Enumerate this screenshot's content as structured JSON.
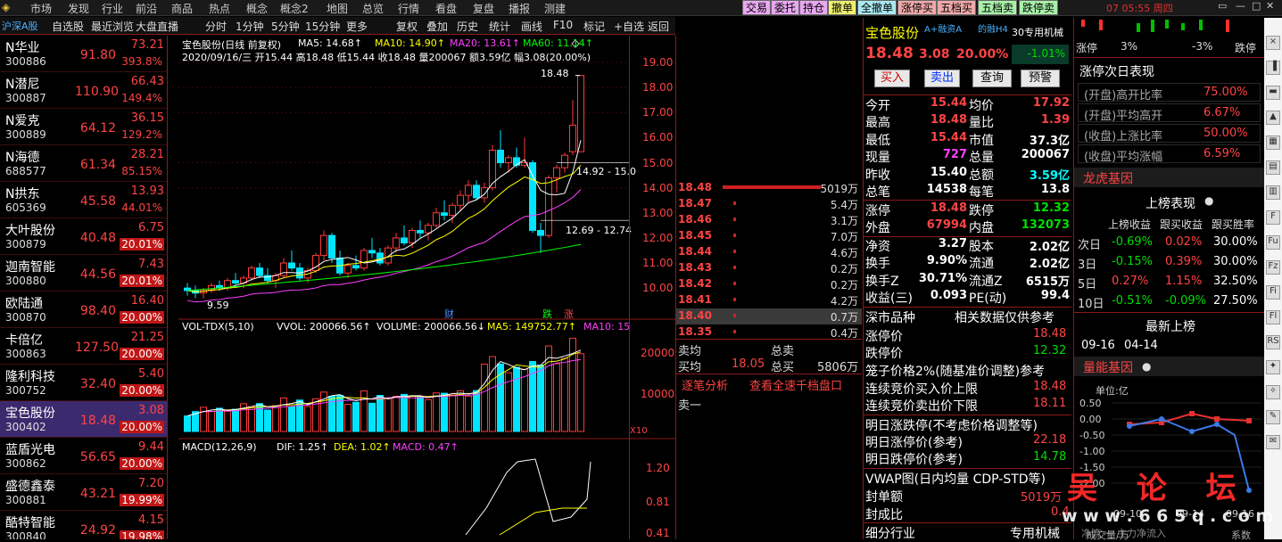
{
  "menu": {
    "items": [
      "市场",
      "发现",
      "行业",
      "前沿",
      "商品",
      "热点",
      "概念",
      "概念2",
      "地图",
      "总览",
      "行情",
      "看盘",
      "复盘",
      "播报",
      "测建"
    ],
    "buttons": [
      {
        "label": "交易",
        "color": "#e8a8f0"
      },
      {
        "label": "委托",
        "color": "#e8a8f0"
      },
      {
        "label": "持仓",
        "color": "#e8a8f0"
      },
      {
        "label": "撤单",
        "color": "#f0f070"
      },
      {
        "label": "全撤单",
        "color": "#a8e8f0"
      },
      {
        "label": "涨停买",
        "color": "#f0a8a8"
      },
      {
        "label": "五档买",
        "color": "#f0a8a8"
      },
      {
        "label": "五档卖",
        "color": "#a8f0a8"
      },
      {
        "label": "跌停卖",
        "color": "#a8f0a8"
      }
    ],
    "clock": "07 05:55 周四"
  },
  "toolbar": {
    "market": "沪深A股",
    "tabs": [
      "自选股",
      "最近浏览",
      "大盘直播"
    ],
    "periods": [
      "分时",
      "1分钟",
      "5分钟",
      "15分钟",
      "更多"
    ],
    "tools": [
      "复权",
      "叠加",
      "历史",
      "统计",
      "画线",
      "F10",
      "标记",
      "+自选",
      "返回"
    ]
  },
  "stocks": [
    {
      "name": "N华业",
      "code": "300886",
      "price": "91.80",
      "change": "73.21",
      "pct": "393.8%",
      "box": false
    },
    {
      "name": "N潜尼",
      "code": "300887",
      "price": "110.90",
      "change": "66.43",
      "pct": "149.4%",
      "box": false
    },
    {
      "name": "N爱克",
      "code": "300889",
      "price": "64.12",
      "change": "36.15",
      "pct": "129.2%",
      "box": false
    },
    {
      "name": "N海德",
      "code": "688577",
      "price": "61.34",
      "change": "28.21",
      "pct": "85.15%",
      "box": false
    },
    {
      "name": "N拱东",
      "code": "605369",
      "price": "45.58",
      "change": "13.93",
      "pct": "44.01%",
      "box": false
    },
    {
      "name": "大叶股份",
      "code": "300879",
      "price": "40.48",
      "change": "6.75",
      "pct": "20.01%",
      "box": true
    },
    {
      "name": "迦南智能",
      "code": "300880",
      "price": "44.56",
      "change": "7.43",
      "pct": "20.01%",
      "box": true
    },
    {
      "name": "欧陆通",
      "code": "300870",
      "price": "98.40",
      "change": "16.40",
      "pct": "20.00%",
      "box": true
    },
    {
      "name": "卡倍亿",
      "code": "300863",
      "price": "127.50",
      "change": "21.25",
      "pct": "20.00%",
      "box": true
    },
    {
      "name": "隆利科技",
      "code": "300752",
      "price": "32.40",
      "change": "5.40",
      "pct": "20.00%",
      "box": true
    },
    {
      "name": "宝色股份",
      "code": "300402",
      "price": "18.48",
      "change": "3.08",
      "pct": "20.00%",
      "box": true
    },
    {
      "name": "蓝盾光电",
      "code": "300862",
      "price": "56.65",
      "change": "9.44",
      "pct": "20.00%",
      "box": true
    },
    {
      "name": "盛德鑫泰",
      "code": "300881",
      "price": "43.21",
      "change": "7.20",
      "pct": "19.99%",
      "box": true
    },
    {
      "name": "酷特智能",
      "code": "300840",
      "price": "24.92",
      "change": "4.15",
      "pct": "19.98%",
      "box": true
    }
  ],
  "chart": {
    "title": "宝色股份(日线 前复权)",
    "ma5": "MA5: 14.68↑",
    "ma10": "MA10: 14.90↑",
    "ma20": "MA20: 13.61↑",
    "ma60": "MA60: 11.14↑",
    "ohlc": "2020/09/16/三 开15.44 高18.48 低15.44 收18.48 量200067 额3.59亿 幅3.08(20.00%)",
    "high_label": "18.48",
    "low_label": "9.59",
    "range1": "14.92 - 15.0",
    "range2": "12.69 - 12.74",
    "event_cai": "财",
    "event_die": "跌",
    "event_zhang": "涨",
    "vol_title": "VOL-TDX(5,10)",
    "vvol": "VVOL: 200066.56↑",
    "volume": "VOLUME: 200066.56↓",
    "vma5": "MA5: 149752.77↑",
    "vma10": "MA10: 15",
    "vol_unit": "X10",
    "macd_title": "MACD(12,26,9)",
    "dif": "DIF: 1.25↑",
    "dea": "DEA: 1.02↑",
    "macd": "MACD: 0.47↑",
    "price_ticks": [
      "19.00",
      "18.00",
      "17.00",
      "16.00",
      "15.00",
      "14.00",
      "13.00",
      "12.00",
      "11.00",
      "10.00"
    ],
    "vol_ticks": [
      "20000",
      "10000"
    ],
    "macd_ticks": [
      "1.20",
      "0.81",
      "0.41"
    ]
  },
  "chart_data": {
    "type": "candlestick",
    "title": "宝色股份(日线 前复权)",
    "candles": [
      [
        10.0,
        10.2,
        9.7,
        9.9
      ],
      [
        9.9,
        10.1,
        9.6,
        9.8
      ],
      [
        9.8,
        10.0,
        9.59,
        9.9
      ],
      [
        9.9,
        10.2,
        9.8,
        10.1
      ],
      [
        10.1,
        10.3,
        9.9,
        10.0
      ],
      [
        10.0,
        10.4,
        9.9,
        10.3
      ],
      [
        10.3,
        10.6,
        10.1,
        10.2
      ],
      [
        10.2,
        10.5,
        10.0,
        10.4
      ],
      [
        10.4,
        10.9,
        10.3,
        10.8
      ],
      [
        10.8,
        11.0,
        10.4,
        10.5
      ],
      [
        10.5,
        10.8,
        10.2,
        10.3
      ],
      [
        10.3,
        10.6,
        10.0,
        10.5
      ],
      [
        10.5,
        11.2,
        10.4,
        11.0
      ],
      [
        11.0,
        11.5,
        10.7,
        10.8
      ],
      [
        10.8,
        11.0,
        10.3,
        10.4
      ],
      [
        10.4,
        10.8,
        10.2,
        10.7
      ],
      [
        10.7,
        11.4,
        10.6,
        11.3
      ],
      [
        11.3,
        12.3,
        11.1,
        12.1
      ],
      [
        12.1,
        12.2,
        11.0,
        11.2
      ],
      [
        11.2,
        11.5,
        10.5,
        10.6
      ],
      [
        10.6,
        11.0,
        10.4,
        10.9
      ],
      [
        10.9,
        11.3,
        10.7,
        10.8
      ],
      [
        10.8,
        11.6,
        10.7,
        11.5
      ],
      [
        11.5,
        12.0,
        11.2,
        11.4
      ],
      [
        11.4,
        11.6,
        10.9,
        11.0
      ],
      [
        11.0,
        11.7,
        10.9,
        11.6
      ],
      [
        11.6,
        12.2,
        11.4,
        12.0
      ],
      [
        12.0,
        12.5,
        11.7,
        11.8
      ],
      [
        11.8,
        12.4,
        11.6,
        12.3
      ],
      [
        12.3,
        12.7,
        12.0,
        12.2
      ],
      [
        12.2,
        12.6,
        11.9,
        12.5
      ],
      [
        12.5,
        13.2,
        12.4,
        13.0
      ],
      [
        13.0,
        13.5,
        12.7,
        12.9
      ],
      [
        12.9,
        13.4,
        12.6,
        13.3
      ],
      [
        13.3,
        13.9,
        13.1,
        13.7
      ],
      [
        13.7,
        14.3,
        13.4,
        14.1
      ],
      [
        14.1,
        14.3,
        13.5,
        13.6
      ],
      [
        13.6,
        14.2,
        13.4,
        14.0
      ],
      [
        14.0,
        15.7,
        13.9,
        15.5
      ],
      [
        15.5,
        16.3,
        14.8,
        15.0
      ],
      [
        15.0,
        15.3,
        14.6,
        15.2
      ],
      [
        15.2,
        15.6,
        14.8,
        14.9
      ],
      [
        14.9,
        16.0,
        14.8,
        15.0
      ],
      [
        15.0,
        15.1,
        12.2,
        12.3
      ],
      [
        12.3,
        12.6,
        11.4,
        12.1
      ],
      [
        12.1,
        14.5,
        12.0,
        14.4
      ],
      [
        14.4,
        14.92,
        13.8,
        14.8
      ],
      [
        14.8,
        15.4,
        14.6,
        15.3
      ],
      [
        15.44,
        17.5,
        15.3,
        16.5
      ],
      [
        15.44,
        18.48,
        15.44,
        18.48
      ]
    ],
    "volume_ylim": [
      0,
      25000
    ],
    "price_ylim": [
      9.4,
      19.5
    ]
  },
  "orderbook": {
    "rows": [
      {
        "price": "18.48",
        "vol": "5019万",
        "w": 110,
        "hl": false
      },
      {
        "price": "18.47",
        "vol": "5.4万",
        "w": 3,
        "hl": false
      },
      {
        "price": "18.46",
        "vol": "3.1万",
        "w": 3,
        "hl": false
      },
      {
        "price": "18.45",
        "vol": "7.0万",
        "w": 3,
        "hl": false
      },
      {
        "price": "18.44",
        "vol": "4.6万",
        "w": 3,
        "hl": false
      },
      {
        "price": "18.43",
        "vol": "0.2万",
        "w": 3,
        "hl": false
      },
      {
        "price": "18.42",
        "vol": "0.2万",
        "w": 3,
        "hl": false
      },
      {
        "price": "18.41",
        "vol": "4.2万",
        "w": 3,
        "hl": false
      },
      {
        "price": "18.40",
        "vol": "0.7万",
        "w": 3,
        "hl": true
      },
      {
        "price": "18.35",
        "vol": "0.4万",
        "w": 3,
        "hl": false
      }
    ],
    "sell_avg": "卖均",
    "buy_avg": "买均",
    "buy_avg_val": "18.05",
    "total_sell": "总卖",
    "total_buy": "总买",
    "total_buy_val": "5806万",
    "link1": "逐笔分析",
    "link2": "查看全速千档盘口",
    "sell1": "卖一"
  },
  "info": {
    "name": "宝色股份",
    "tag": "A+融资A",
    "tag2": "的融H4",
    "industry": "30专用机械",
    "price": "18.48",
    "chg": "3.08",
    "pct": "20.00%",
    "sub_pct": "-1.01%",
    "btn_buy": "买入",
    "btn_sell": "卖出",
    "btn_query": "查询",
    "btn_alert": "预警",
    "stats": [
      [
        "今开",
        "15.44",
        "red",
        "均价",
        "17.92",
        "red"
      ],
      [
        "最高",
        "18.48",
        "red",
        "量比",
        "1.39",
        "red"
      ],
      [
        "最低",
        "15.44",
        "red",
        "市值",
        "37.3亿",
        "white"
      ],
      [
        "现量",
        "727",
        "magenta",
        "总量",
        "200067",
        "white"
      ],
      [
        "昨收",
        "15.40",
        "white",
        "总额",
        "3.59亿",
        "cyan"
      ],
      [
        "总笔",
        "14538",
        "white",
        "每笔",
        "13.8",
        "white"
      ]
    ],
    "stats2": [
      [
        "涨停",
        "18.48",
        "red",
        "跌停",
        "12.32",
        "green"
      ],
      [
        "外盘",
        "67994",
        "red",
        "内盘",
        "132073",
        "green"
      ]
    ],
    "stats3": [
      [
        "净资",
        "3.27",
        "white",
        "股本",
        "2.02亿",
        "white"
      ],
      [
        "换手",
        "9.90%",
        "white",
        "流通",
        "2.02亿",
        "white"
      ],
      [
        "换手Z",
        "30.71%",
        "white",
        "流通Z",
        "6515万",
        "white"
      ],
      [
        "收益(三)",
        "0.093",
        "white",
        "PE(动)",
        "99.4",
        "white"
      ]
    ],
    "sec1_left": "深市品种",
    "sec1_right": "相关数据仅供参考",
    "limit_up_label": "涨停价",
    "limit_up": "18.48",
    "limit_down_label": "跌停价",
    "limit_down": "12.32",
    "cage": "笼子价格2%(随基准价调整)参考",
    "auc_up_label": "连续竞价买入价上限",
    "auc_up": "18.48",
    "auc_down_label": "连续竞价卖出价下限",
    "auc_down": "18.11",
    "tomorrow": "明日涨跌停(不考虑价格调整等)",
    "tm_up_label": "明日涨停价(参考)",
    "tm_up": "22.18",
    "tm_down_label": "明日跌停价(参考)",
    "tm_down": "14.78",
    "vwap": "VWAP图(日内均量 CDP-STD等)",
    "seal_amt": "封单额",
    "seal_amt_val": "5019万",
    "seal_ratio": "封成比",
    "seal_ratio_val": "0.4",
    "sub_industry": "细分行业",
    "sub_industry_val": "专用机械"
  },
  "rpanel": {
    "limit_up": "涨停",
    "p3": "3%",
    "m3": "-3%",
    "limit_down": "跌停",
    "title1": "涨停次日表现",
    "rows1": [
      [
        "(开盘)高开比率",
        "75.00%"
      ],
      [
        "(开盘)平均高开",
        "6.67%"
      ],
      [
        "(收盘)上涨比率",
        "50.00%"
      ],
      [
        "(收盘)平均涨幅",
        "6.59%"
      ]
    ],
    "title2": "龙虎基因",
    "title3": "上榜表现",
    "cols": [
      "上榜收益",
      "跟买收益",
      "跟买胜率"
    ],
    "rows2": [
      [
        "次日",
        "-0.69%",
        "green",
        "0.02%",
        "red",
        "30.00%"
      ],
      [
        "3日",
        "-0.15%",
        "green",
        "0.39%",
        "red",
        "30.00%"
      ],
      [
        "5日",
        "0.27%",
        "red",
        "1.15%",
        "red",
        "32.50%"
      ],
      [
        "10日",
        "-0.51%",
        "green",
        "-0.09%",
        "green",
        "27.50%"
      ]
    ],
    "latest": "最新上榜",
    "dates": [
      "09-16",
      "04-14"
    ],
    "title4": "量能基因",
    "unit": "单位:亿",
    "yticks": [
      "0.50",
      "0.00",
      "-0.50",
      "-1.00",
      "-1.50",
      "-2.00"
    ],
    "xticks": [
      "09-10",
      "09-14",
      "09-16"
    ],
    "footer1": "成交量/万",
    "footer2": "系数",
    "legend": "净流 一 主力净流入"
  },
  "watermark": {
    "text": "吴 论 坛",
    "url": "w w w . 6 6 5 q . c o m"
  }
}
